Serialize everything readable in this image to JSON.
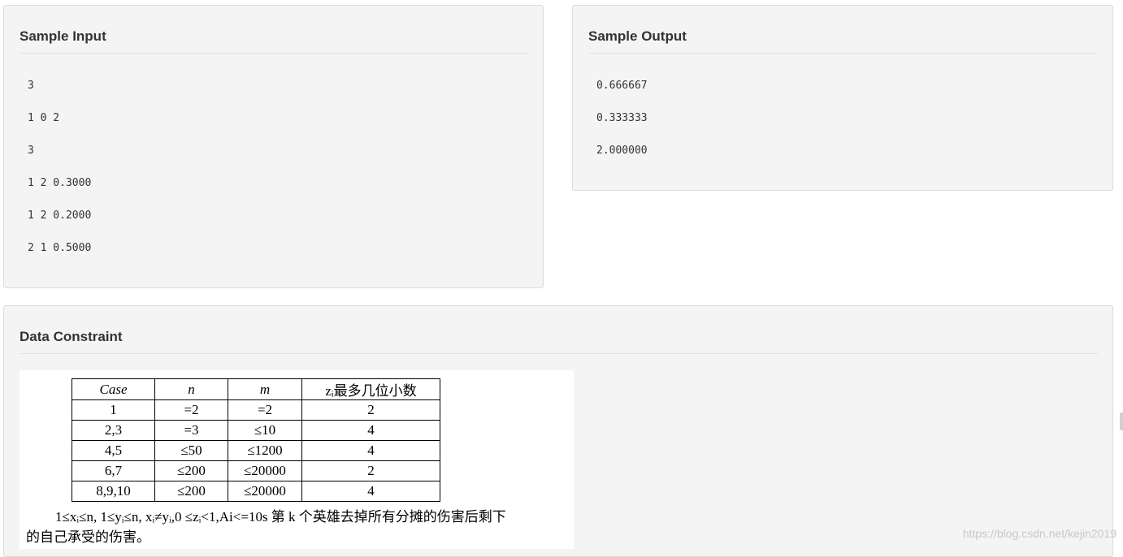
{
  "sample_input": {
    "title": "Sample Input",
    "lines": [
      "3",
      "1 0 2",
      "3",
      "1 2 0.3000",
      "1 2 0.2000",
      "2 1 0.5000"
    ]
  },
  "sample_output": {
    "title": "Sample Output",
    "lines": [
      "0.666667",
      "0.333333",
      "2.000000"
    ]
  },
  "data_constraint": {
    "title": "Data Constraint",
    "table": {
      "headers": [
        "Case",
        "n",
        "m",
        "zᵢ最多几位小数"
      ],
      "rows": [
        [
          "1",
          "=2",
          "=2",
          "2"
        ],
        [
          "2,3",
          "=3",
          "≤10",
          "4"
        ],
        [
          "4,5",
          "≤50",
          "≤1200",
          "4"
        ],
        [
          "6,7",
          "≤200",
          "≤20000",
          "2"
        ],
        [
          "8,9,10",
          "≤200",
          "≤20000",
          "4"
        ]
      ]
    },
    "description_line1": "1≤xᵢ≤n, 1≤yᵢ≤n, xᵢ≠yᵢ,0 ≤zᵢ<1,Ai<=10s 第 k 个英雄去掉所有分摊的伤害后剩下",
    "description_line2": "的自己承受的伤害。"
  },
  "watermark": "https://blog.csdn.net/kejin2019"
}
